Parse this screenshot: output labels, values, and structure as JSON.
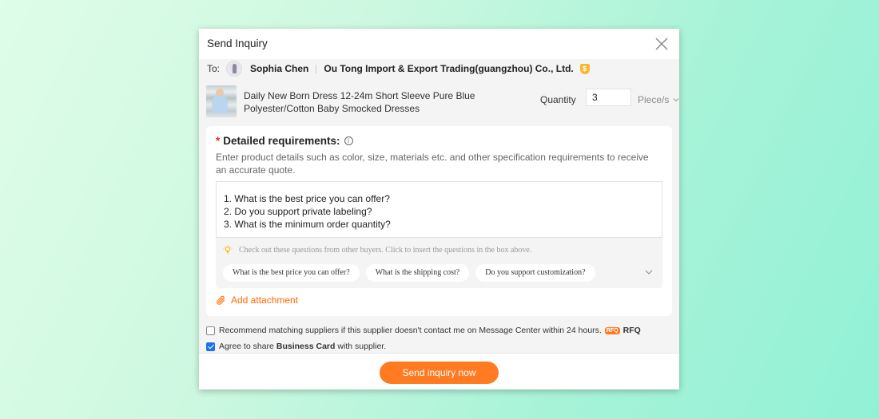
{
  "modal": {
    "title": "Send Inquiry",
    "close_icon": "close-icon"
  },
  "recipient": {
    "to_label": "To:",
    "contact_name": "Sophia Chen",
    "company_name": "Ou Tong Import & Export Trading(guangzhou) Co., Ltd.",
    "verified_badge": "$"
  },
  "product": {
    "name_line1": "Daily New Born Dress 12-24m Short Sleeve Pure Blue",
    "name_line2": "Polyester/Cotton Baby Smocked Dresses",
    "quantity_label": "Quantity",
    "quantity_value": "3",
    "unit": "Piece/s"
  },
  "requirements": {
    "required_marker": "*",
    "title": "Detailed requirements:",
    "info_icon": "i",
    "description": "Enter product details such as color, size, materials etc. and other specification requirements to receive an accurate quote.",
    "textarea_value": "1. What is the best price you can offer?\n2. Do you support private labeling?\n3. What is the minimum order quantity?",
    "suggest_hint": "Check out these questions from other buyers. Click to insert the questions in the box above.",
    "suggestions": [
      "What is the best price you can offer?",
      "What is the shipping cost?",
      "Do you support customization?"
    ],
    "attachment_label": "Add attachment"
  },
  "options": {
    "recommend": {
      "checked": false,
      "label": "Recommend matching suppliers if this supplier doesn't contact me on Message Center within 24 hours.",
      "badge": "RFQ",
      "badge_text": "RFQ"
    },
    "share_card": {
      "checked": true,
      "label_prefix": "Agree to share",
      "label_bold": "Business Card",
      "label_suffix": "with supplier."
    }
  },
  "footer": {
    "send_label": "Send inquiry now"
  },
  "colors": {
    "accent": "#ff7a21",
    "link": "#ff6a00",
    "required": "#e62e04",
    "checkbox": "#1a73e8"
  }
}
